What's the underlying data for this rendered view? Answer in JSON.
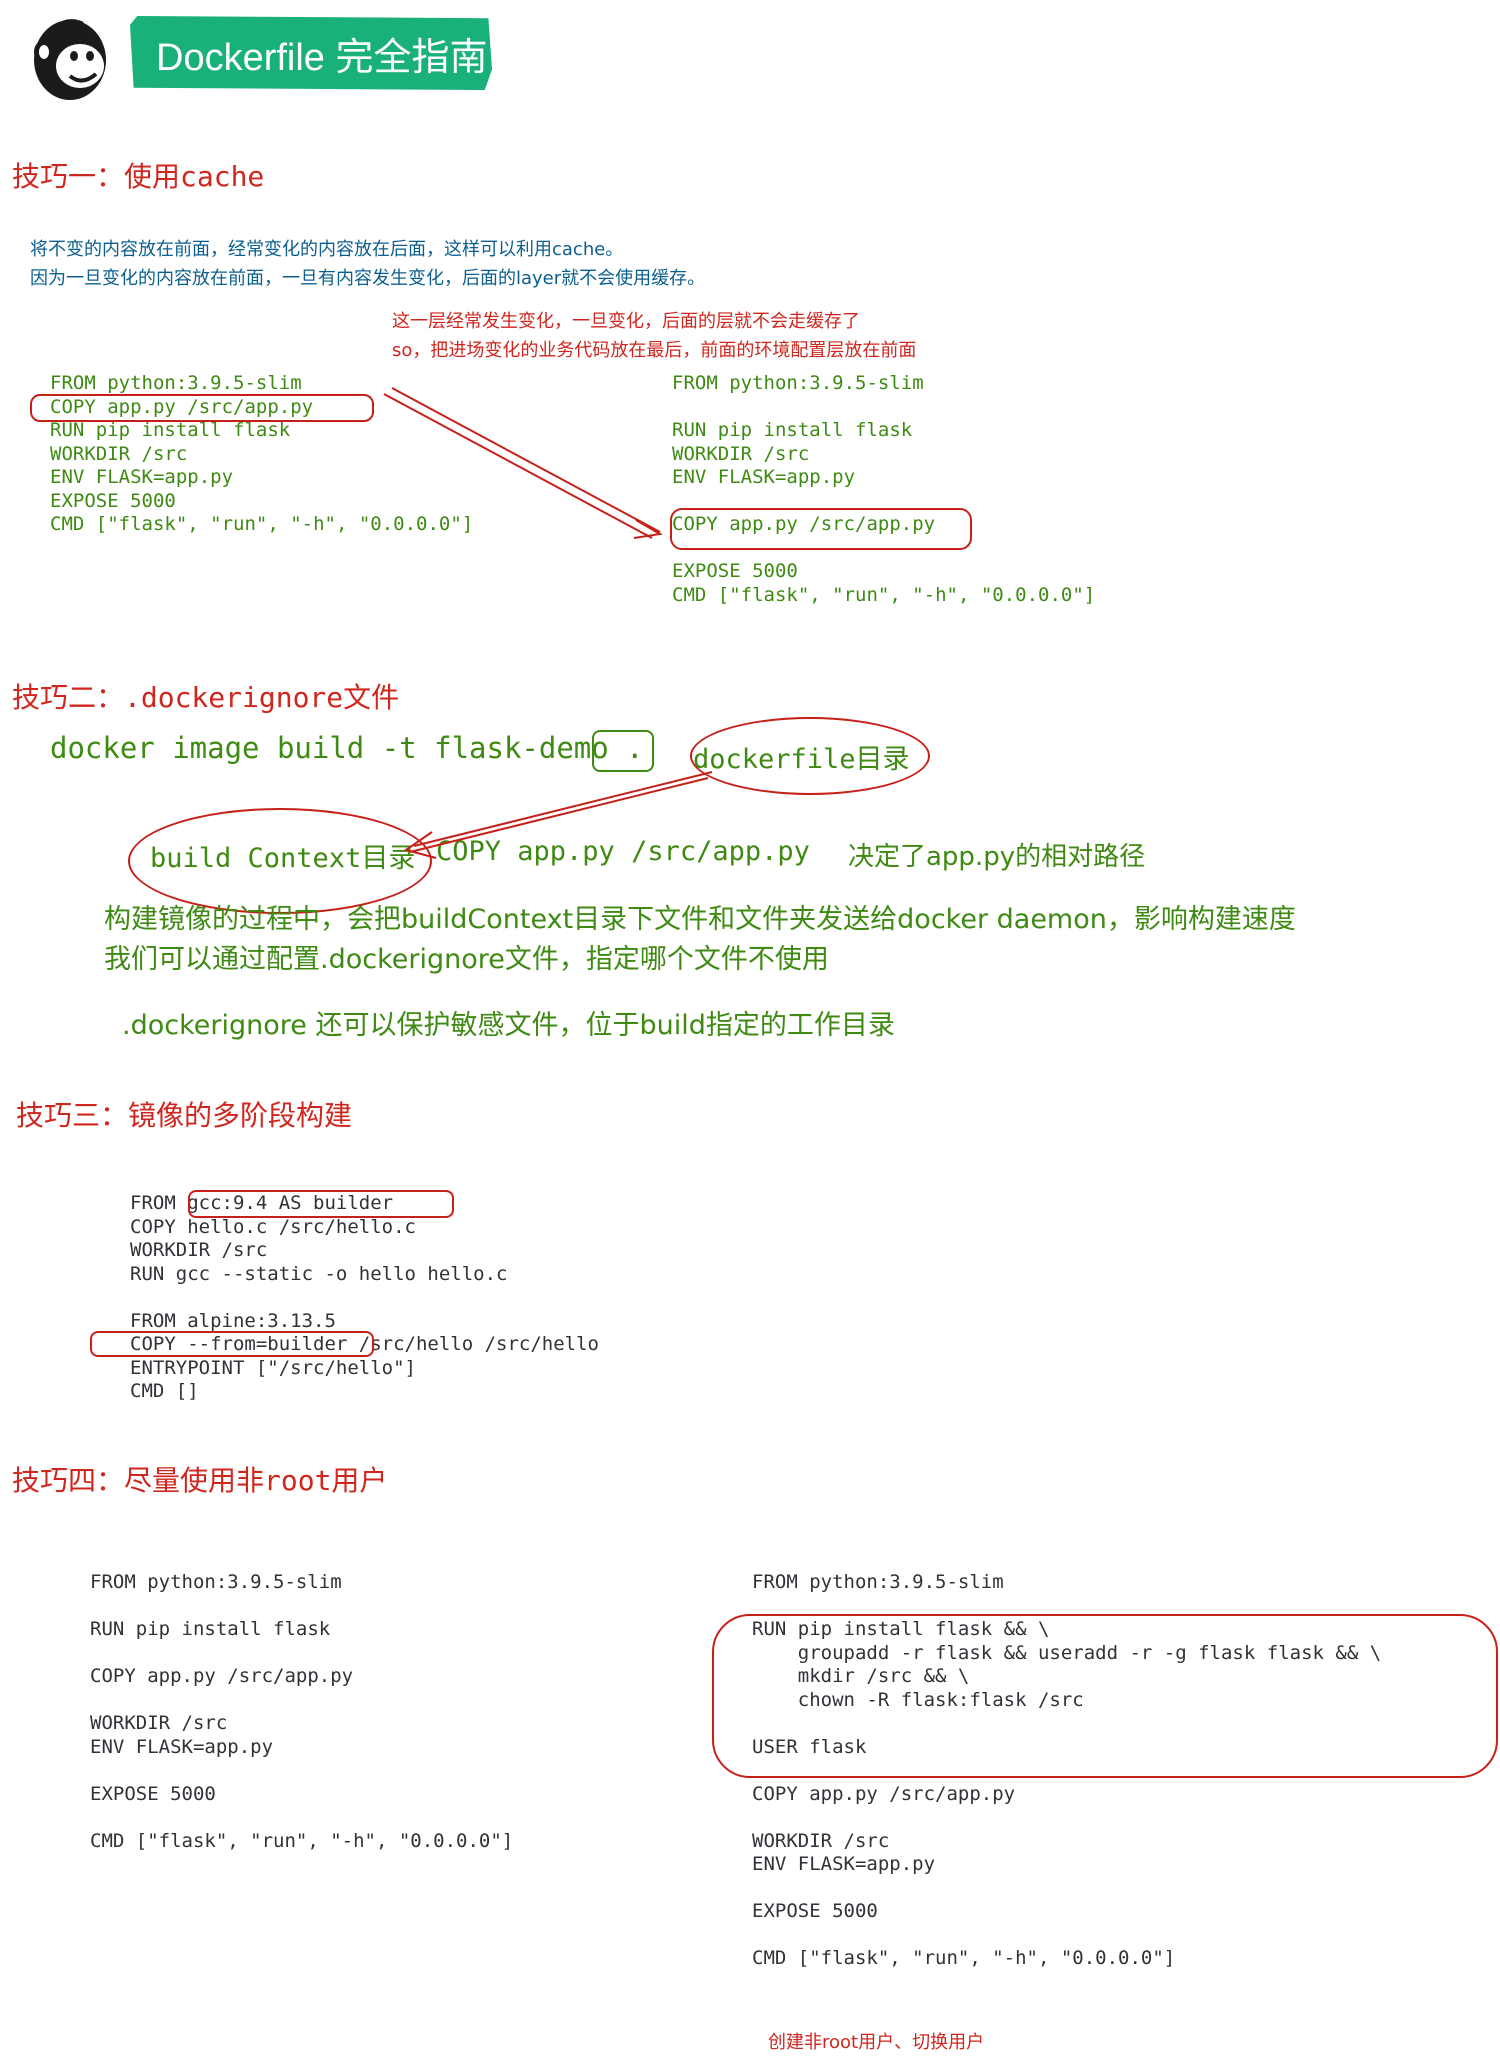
{
  "header": {
    "title": "Dockerfile 完全指南",
    "logo": "mailchimp-monkey-logo"
  },
  "tip1": {
    "heading": "技巧一：使用cache",
    "desc_line1": "将不变的内容放在前面，经常变化的内容放在后面，这样可以利用cache。",
    "desc_line2": "因为一旦变化的内容放在前面，一旦有内容发生变化，后面的layer就不会使用缓存。",
    "note_line1": "这一层经常发生变化，一旦变化，后面的层就不会走缓存了",
    "note_line2": "so，把进场变化的业务代码放在最后，前面的环境配置层放在前面",
    "left_code": "FROM python:3.9.5-slim\nCOPY app.py /src/app.py\nRUN pip install flask\nWORKDIR /src\nENV FLASK=app.py\nEXPOSE 5000\nCMD [\"flask\", \"run\", \"-h\", \"0.0.0.0\"]",
    "right_code": "FROM python:3.9.5-slim\n\nRUN pip install flask\nWORKDIR /src\nENV FLASK=app.py\n\nCOPY app.py /src/app.py\n\nEXPOSE 5000\nCMD [\"flask\", \"run\", \"-h\", \"0.0.0.0\"]"
  },
  "tip2": {
    "heading": "技巧二：.dockerignore文件",
    "command": "docker image build -t flask-demo .",
    "dockerfile_label": "dockerfile目录",
    "context_label": "build Context目录",
    "copy_cmd": "COPY app.py /src/app.py",
    "copy_note": "决定了app.py的相对路径",
    "line1": "构建镜像的过程中，会把buildContext目录下文件和文件夹发送给docker daemon，影响构建速度",
    "line2": "我们可以通过配置.dockerignore文件，指定哪个文件不使用",
    "line3": ".dockerignore 还可以保护敏感文件，位于build指定的工作目录"
  },
  "tip3": {
    "heading": "技巧三：镜像的多阶段构建",
    "code": "FROM gcc:9.4 AS builder\nCOPY hello.c /src/hello.c\nWORKDIR /src\nRUN gcc --static -o hello hello.c\n\nFROM alpine:3.13.5\nCOPY --from=builder /src/hello /src/hello\nENTRYPOINT [\"/src/hello\"]\nCMD []"
  },
  "tip4": {
    "heading": "技巧四：尽量使用非root用户",
    "left_code": "FROM python:3.9.5-slim\n\nRUN pip install flask\n\nCOPY app.py /src/app.py\n\nWORKDIR /src\nENV FLASK=app.py\n\nEXPOSE 5000\n\nCMD [\"flask\", \"run\", \"-h\", \"0.0.0.0\"]",
    "right_code": "FROM python:3.9.5-slim\n\nRUN pip install flask && \\\n    groupadd -r flask && useradd -r -g flask flask && \\\n    mkdir /src && \\\n    chown -R flask:flask /src\n\nUSER flask\n\nCOPY app.py /src/app.py\n\nWORKDIR /src\nENV FLASK=app.py\n\nEXPOSE 5000\n\nCMD [\"flask\", \"run\", \"-h\", \"0.0.0.0\"]",
    "note": "创建非root用户、切换用户"
  },
  "colors": {
    "accent_green": "#19b07a",
    "annotation_red": "#c62019",
    "heading_red": "#d0261e",
    "code_green": "#3e8a12",
    "note_blue": "#0b5f8f"
  }
}
